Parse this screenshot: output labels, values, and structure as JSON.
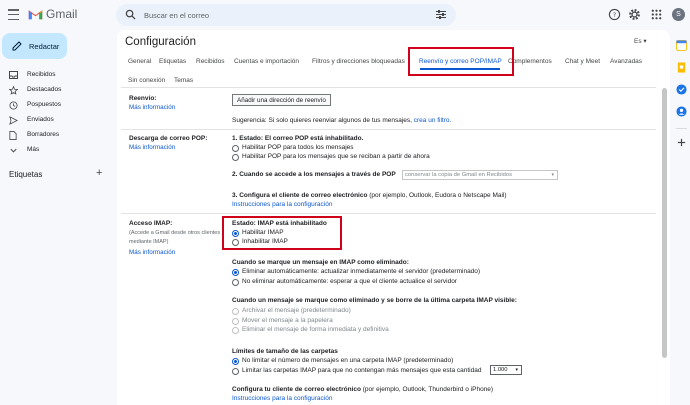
{
  "app": {
    "title": "Gmail"
  },
  "search": {
    "placeholder": "Buscar en el correo"
  },
  "avatar": {
    "letter": "S"
  },
  "compose": {
    "label": "Redactar"
  },
  "nav": {
    "items": [
      {
        "label": "Recibidos",
        "icon": "inbox-icon"
      },
      {
        "label": "Destacados",
        "icon": "star-icon"
      },
      {
        "label": "Pospuestos",
        "icon": "clock-icon"
      },
      {
        "label": "Enviados",
        "icon": "send-icon"
      },
      {
        "label": "Borradores",
        "icon": "draft-icon"
      },
      {
        "label": "Más",
        "icon": "chevron-down-icon"
      }
    ],
    "labels_title": "Etiquetas",
    "labels_add": "+"
  },
  "settings": {
    "title": "Configuración",
    "lang": "Es",
    "tabs": [
      "General",
      "Etiquetas",
      "Recibidos",
      "Cuentas e importación",
      "Filtros y direcciones bloqueadas",
      "Reenvío y correo POP/IMAP",
      "Complementos",
      "Chat y Meet",
      "Avanzadas",
      "Sin conexión",
      "Temas"
    ],
    "active_tab": "Reenvío y correo POP/IMAP"
  },
  "forwarding": {
    "title": "Reenvío:",
    "more": "Más información",
    "button": "Añadir una dirección de reenvío",
    "tip": "Sugerencia: Si solo quieres reenviar algunos de tus mensajes,",
    "tip_link": "crea un filtro."
  },
  "pop": {
    "title": "Descarga de correo POP:",
    "more": "Más información",
    "status": "1. Estado: El correo POP está inhabilitado.",
    "opt_all": "Habilitar POP para todos los mensajes",
    "opt_from_now": "Habilitar POP para los mensajes que se reciban a partir de ahora",
    "access_label": "2. Cuando se accede a los mensajes a través de POP",
    "access_select": "conservar la copia de Gmail en Recibidos",
    "client_label": "3. Configura el cliente de correo electrónico",
    "client_examples": "(por ejemplo, Outlook, Eudora o Netscape Mail)",
    "client_link": "Instrucciones para la configuración"
  },
  "imap": {
    "title": "Acceso IMAP:",
    "subtitle": "(Accede a Gmail desde otros clientes mediante IMAP)",
    "more": "Más información",
    "status": "Estado: IMAP está inhabilitado",
    "opt_enable": "Habilitar IMAP",
    "opt_disable": "Inhabilitar IMAP",
    "deleted_title": "Cuando se marque un mensaje en IMAP como eliminado:",
    "deleted_opt1": "Eliminar automáticamente: actualizar inmediatamente el servidor (predeterminado)",
    "deleted_opt2": "No eliminar automáticamente: esperar a que el cliente actualice el servidor",
    "expunge_title": "Cuando un mensaje se marque como eliminado y se borre de la última carpeta IMAP visible:",
    "expunge_opt1": "Archivar el mensaje (predeterminado)",
    "expunge_opt2": "Mover el mensaje a la papelera",
    "expunge_opt3": "Eliminar el mensaje de forma inmediata y definitiva",
    "limits_title": "Límites de tamaño de las carpetas",
    "limits_opt1": "No limitar el número de mensajes en una carpeta IMAP (predeterminado)",
    "limits_opt2": "Limitar las carpetas IMAP para que no contengan más mensajes que esta cantidad",
    "limits_select": "1.000",
    "client_title": "Configura tu cliente de correo electrónico",
    "client_examples": "(por ejemplo, Outlook, Thunderbird o iPhone)",
    "client_link": "Instrucciones para la configuración"
  },
  "colors": {
    "accent": "#0b57d0",
    "highlight": "#d0021b",
    "compose": "#c2e7ff"
  }
}
